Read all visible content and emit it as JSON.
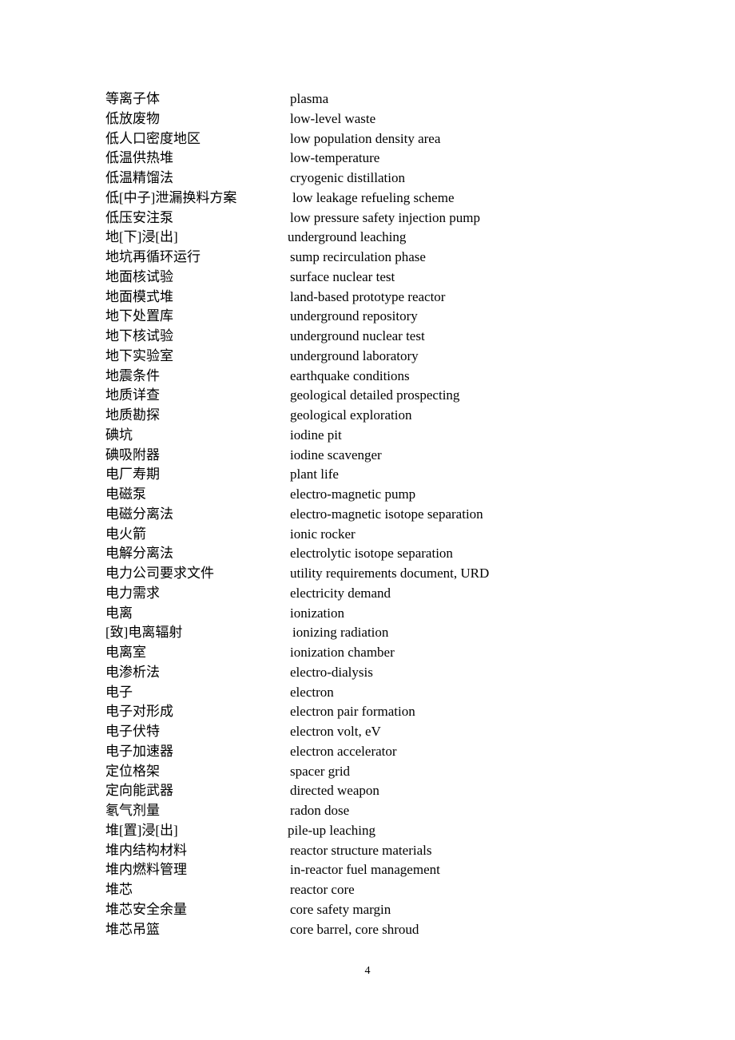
{
  "document": {
    "entries": [
      {
        "zh": "等离子体",
        "en": "plasma"
      },
      {
        "zh": "低放废物",
        "en": "low-level waste"
      },
      {
        "zh": "低人口密度地区",
        "en": "low population density area"
      },
      {
        "zh": "低温供热堆",
        "en": "low-temperature"
      },
      {
        "zh": "低温精馏法",
        "en": "cryogenic distillation"
      },
      {
        "zh": "低[中子]泄漏换料方案",
        "en": "low leakage refueling scheme"
      },
      {
        "zh": "低压安注泵",
        "en": "low pressure safety injection pump"
      },
      {
        "zh": "地[下]浸[出]",
        "en": "underground leaching"
      },
      {
        "zh": "地坑再循环运行",
        "en": "sump recirculation phase"
      },
      {
        "zh": "地面核试验",
        "en": "surface nuclear test"
      },
      {
        "zh": "地面模式堆",
        "en": "land-based prototype reactor"
      },
      {
        "zh": "地下处置库",
        "en": "underground repository"
      },
      {
        "zh": "地下核试验",
        "en": "underground nuclear test"
      },
      {
        "zh": "地下实验室",
        "en": "underground laboratory"
      },
      {
        "zh": "地震条件",
        "en": "earthquake conditions"
      },
      {
        "zh": "地质详查",
        "en": "geological detailed prospecting"
      },
      {
        "zh": "地质勘探",
        "en": "geological exploration"
      },
      {
        "zh": "碘坑",
        "en": "iodine pit"
      },
      {
        "zh": "碘吸附器",
        "en": "iodine scavenger"
      },
      {
        "zh": "电厂寿期",
        "en": "plant life"
      },
      {
        "zh": "电磁泵",
        "en": "electro-magnetic pump"
      },
      {
        "zh": "电磁分离法",
        "en": "electro-magnetic isotope separation"
      },
      {
        "zh": "电火箭",
        "en": "ionic rocker"
      },
      {
        "zh": "电解分离法",
        "en": "electrolytic isotope separation"
      },
      {
        "zh": "电力公司要求文件",
        "en": "utility requirements document, URD"
      },
      {
        "zh": "电力需求",
        "en": "electricity demand"
      },
      {
        "zh": "电离",
        "en": "ionization"
      },
      {
        "zh": "[致]电离辐射",
        "en": "ionizing radiation"
      },
      {
        "zh": "电离室",
        "en": "ionization chamber"
      },
      {
        "zh": "电渗析法",
        "en": "electro-dialysis"
      },
      {
        "zh": "电子",
        "en": "electron"
      },
      {
        "zh": "电子对形成",
        "en": "electron pair formation"
      },
      {
        "zh": "电子伏特",
        "en": "electron volt, eV"
      },
      {
        "zh": "电子加速器",
        "en": "electron accelerator"
      },
      {
        "zh": "定位格架",
        "en": "spacer grid"
      },
      {
        "zh": "定向能武器",
        "en": "directed weapon"
      },
      {
        "zh": "氡气剂量",
        "en": "radon dose"
      },
      {
        "zh": "堆[置]浸[出]",
        "en": "pile-up leaching"
      },
      {
        "zh": "堆内结构材料",
        "en": "reactor structure materials"
      },
      {
        "zh": "堆内燃料管理",
        "en": "in-reactor fuel management"
      },
      {
        "zh": "堆芯",
        "en": "reactor core"
      },
      {
        "zh": "堆芯安全余量",
        "en": "core safety margin"
      },
      {
        "zh": "堆芯吊篮",
        "en": "core barrel, core shroud"
      }
    ],
    "page_number": "4"
  }
}
